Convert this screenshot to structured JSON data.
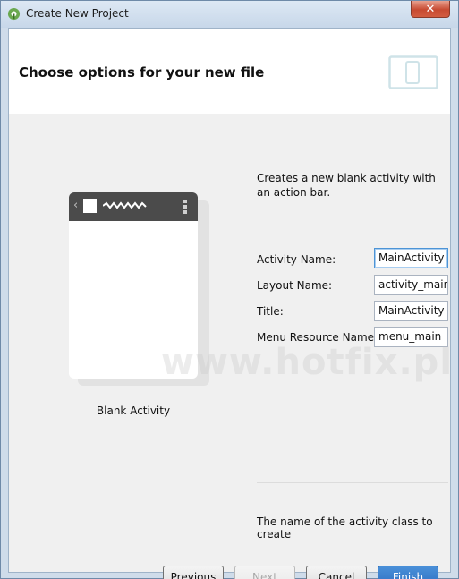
{
  "window": {
    "title": "Create New Project",
    "close_label": "✕"
  },
  "header": {
    "title": "Choose options for your new file"
  },
  "template": {
    "name": "Blank Activity",
    "description": "Creates a new blank activity with an action bar."
  },
  "form": {
    "activity_name": {
      "label": "Activity Name:",
      "value": "MainActivity"
    },
    "layout_name": {
      "label": "Layout Name:",
      "value": "activity_main"
    },
    "title": {
      "label": "Title:",
      "value": "MainActivity"
    },
    "menu_resource_name": {
      "label": "Menu Resource Name:",
      "value": "menu_main"
    }
  },
  "help": {
    "text": "The name of the activity class to create"
  },
  "buttons": {
    "previous": "Previous",
    "next": "Next",
    "cancel": "Cancel",
    "finish": "Finish"
  },
  "watermark": "www.hotfix.pl",
  "colors": {
    "accent": "#2f6fc1",
    "action_bar": "#4b4b4b",
    "device_icon": "#cfe3e8"
  }
}
